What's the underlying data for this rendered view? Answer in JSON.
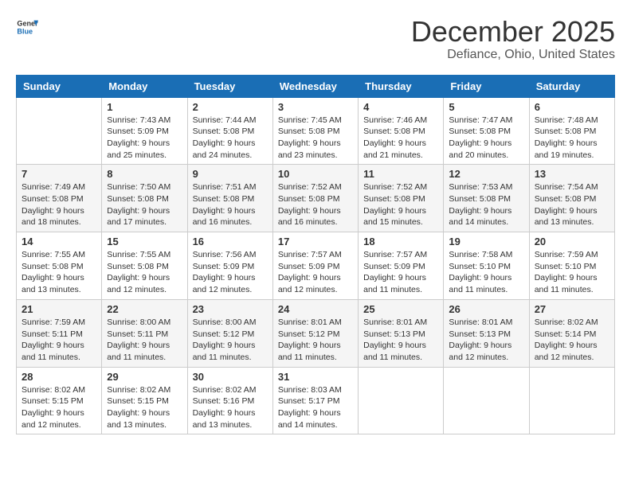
{
  "header": {
    "logo_general": "General",
    "logo_blue": "Blue",
    "month": "December 2025",
    "location": "Defiance, Ohio, United States"
  },
  "weekdays": [
    "Sunday",
    "Monday",
    "Tuesday",
    "Wednesday",
    "Thursday",
    "Friday",
    "Saturday"
  ],
  "weeks": [
    [
      {
        "day": "",
        "info": ""
      },
      {
        "day": "1",
        "info": "Sunrise: 7:43 AM\nSunset: 5:09 PM\nDaylight: 9 hours\nand 25 minutes."
      },
      {
        "day": "2",
        "info": "Sunrise: 7:44 AM\nSunset: 5:08 PM\nDaylight: 9 hours\nand 24 minutes."
      },
      {
        "day": "3",
        "info": "Sunrise: 7:45 AM\nSunset: 5:08 PM\nDaylight: 9 hours\nand 23 minutes."
      },
      {
        "day": "4",
        "info": "Sunrise: 7:46 AM\nSunset: 5:08 PM\nDaylight: 9 hours\nand 21 minutes."
      },
      {
        "day": "5",
        "info": "Sunrise: 7:47 AM\nSunset: 5:08 PM\nDaylight: 9 hours\nand 20 minutes."
      },
      {
        "day": "6",
        "info": "Sunrise: 7:48 AM\nSunset: 5:08 PM\nDaylight: 9 hours\nand 19 minutes."
      }
    ],
    [
      {
        "day": "7",
        "info": "Sunrise: 7:49 AM\nSunset: 5:08 PM\nDaylight: 9 hours\nand 18 minutes."
      },
      {
        "day": "8",
        "info": "Sunrise: 7:50 AM\nSunset: 5:08 PM\nDaylight: 9 hours\nand 17 minutes."
      },
      {
        "day": "9",
        "info": "Sunrise: 7:51 AM\nSunset: 5:08 PM\nDaylight: 9 hours\nand 16 minutes."
      },
      {
        "day": "10",
        "info": "Sunrise: 7:52 AM\nSunset: 5:08 PM\nDaylight: 9 hours\nand 16 minutes."
      },
      {
        "day": "11",
        "info": "Sunrise: 7:52 AM\nSunset: 5:08 PM\nDaylight: 9 hours\nand 15 minutes."
      },
      {
        "day": "12",
        "info": "Sunrise: 7:53 AM\nSunset: 5:08 PM\nDaylight: 9 hours\nand 14 minutes."
      },
      {
        "day": "13",
        "info": "Sunrise: 7:54 AM\nSunset: 5:08 PM\nDaylight: 9 hours\nand 13 minutes."
      }
    ],
    [
      {
        "day": "14",
        "info": "Sunrise: 7:55 AM\nSunset: 5:08 PM\nDaylight: 9 hours\nand 13 minutes."
      },
      {
        "day": "15",
        "info": "Sunrise: 7:55 AM\nSunset: 5:08 PM\nDaylight: 9 hours\nand 12 minutes."
      },
      {
        "day": "16",
        "info": "Sunrise: 7:56 AM\nSunset: 5:09 PM\nDaylight: 9 hours\nand 12 minutes."
      },
      {
        "day": "17",
        "info": "Sunrise: 7:57 AM\nSunset: 5:09 PM\nDaylight: 9 hours\nand 12 minutes."
      },
      {
        "day": "18",
        "info": "Sunrise: 7:57 AM\nSunset: 5:09 PM\nDaylight: 9 hours\nand 11 minutes."
      },
      {
        "day": "19",
        "info": "Sunrise: 7:58 AM\nSunset: 5:10 PM\nDaylight: 9 hours\nand 11 minutes."
      },
      {
        "day": "20",
        "info": "Sunrise: 7:59 AM\nSunset: 5:10 PM\nDaylight: 9 hours\nand 11 minutes."
      }
    ],
    [
      {
        "day": "21",
        "info": "Sunrise: 7:59 AM\nSunset: 5:11 PM\nDaylight: 9 hours\nand 11 minutes."
      },
      {
        "day": "22",
        "info": "Sunrise: 8:00 AM\nSunset: 5:11 PM\nDaylight: 9 hours\nand 11 minutes."
      },
      {
        "day": "23",
        "info": "Sunrise: 8:00 AM\nSunset: 5:12 PM\nDaylight: 9 hours\nand 11 minutes."
      },
      {
        "day": "24",
        "info": "Sunrise: 8:01 AM\nSunset: 5:12 PM\nDaylight: 9 hours\nand 11 minutes."
      },
      {
        "day": "25",
        "info": "Sunrise: 8:01 AM\nSunset: 5:13 PM\nDaylight: 9 hours\nand 11 minutes."
      },
      {
        "day": "26",
        "info": "Sunrise: 8:01 AM\nSunset: 5:13 PM\nDaylight: 9 hours\nand 12 minutes."
      },
      {
        "day": "27",
        "info": "Sunrise: 8:02 AM\nSunset: 5:14 PM\nDaylight: 9 hours\nand 12 minutes."
      }
    ],
    [
      {
        "day": "28",
        "info": "Sunrise: 8:02 AM\nSunset: 5:15 PM\nDaylight: 9 hours\nand 12 minutes."
      },
      {
        "day": "29",
        "info": "Sunrise: 8:02 AM\nSunset: 5:15 PM\nDaylight: 9 hours\nand 13 minutes."
      },
      {
        "day": "30",
        "info": "Sunrise: 8:02 AM\nSunset: 5:16 PM\nDaylight: 9 hours\nand 13 minutes."
      },
      {
        "day": "31",
        "info": "Sunrise: 8:03 AM\nSunset: 5:17 PM\nDaylight: 9 hours\nand 14 minutes."
      },
      {
        "day": "",
        "info": ""
      },
      {
        "day": "",
        "info": ""
      },
      {
        "day": "",
        "info": ""
      }
    ]
  ]
}
